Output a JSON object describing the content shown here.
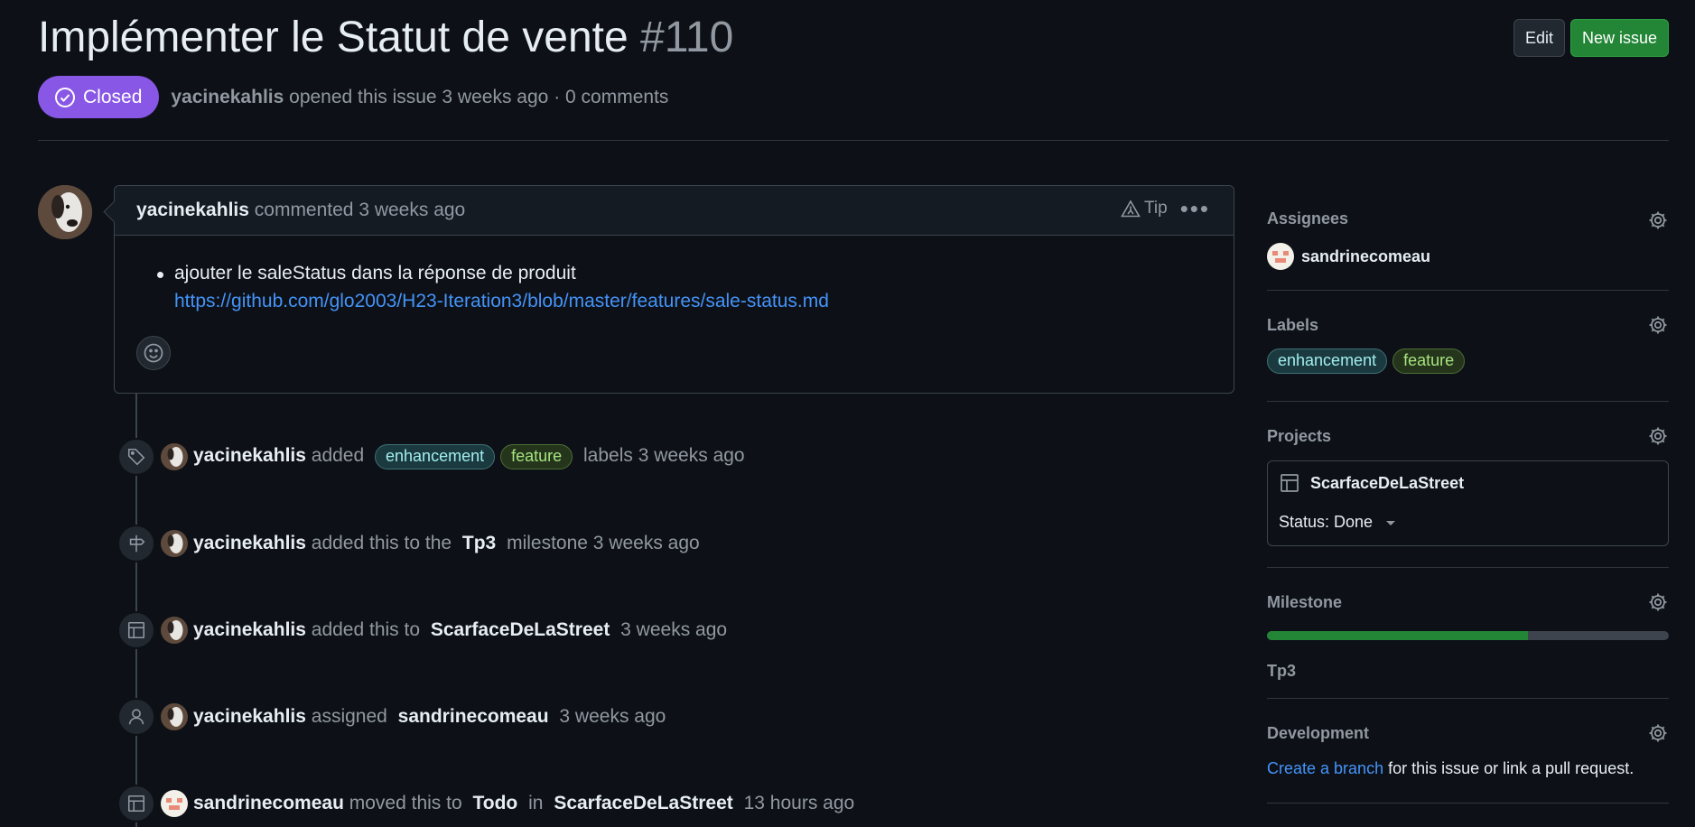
{
  "issue": {
    "title": "Implémenter le Statut de vente",
    "number": "#110",
    "state": "Closed",
    "author": "yacinekahlis",
    "opened_text": "opened this issue 3 weeks ago",
    "sep": "·",
    "comments": "0 comments"
  },
  "header_buttons": {
    "edit": "Edit",
    "new_issue": "New issue"
  },
  "comment": {
    "author": "yacinekahlis",
    "meta": "commented 3 weeks ago",
    "tip": "Tip",
    "more": "•••",
    "bullet_text": "ajouter le saleStatus dans la réponse de produit",
    "link": "https://github.com/glo2003/H23-Iteration3/blob/master/features/sale-status.md"
  },
  "timeline": [
    {
      "icon": "tag-icon",
      "actor": "yacinekahlis",
      "parts": [
        "added"
      ],
      "labels": [
        "enhancement",
        "feature"
      ],
      "tail": "labels 3 weeks ago"
    },
    {
      "icon": "milestone-icon",
      "actor": "yacinekahlis",
      "text1": "added this to the",
      "bold1": "Tp3",
      "text2": "milestone 3 weeks ago"
    },
    {
      "icon": "table-icon",
      "actor": "yacinekahlis",
      "text1": "added this to",
      "bold1": "ScarfaceDeLaStreet",
      "text2": "3 weeks ago"
    },
    {
      "icon": "person-icon",
      "actor": "yacinekahlis",
      "text1": "assigned",
      "bold1": "sandrinecomeau",
      "text2": "3 weeks ago"
    },
    {
      "icon": "table-icon",
      "actor": "sandrinecomeau",
      "text1": "moved this to",
      "bold1": "Todo",
      "text2": "in",
      "bold2": "ScarfaceDeLaStreet",
      "text3": "13 hours ago"
    }
  ],
  "sidebar": {
    "assignees": {
      "title": "Assignees",
      "name": "sandrinecomeau"
    },
    "labels": {
      "title": "Labels",
      "items": [
        "enhancement",
        "feature"
      ]
    },
    "projects": {
      "title": "Projects",
      "name": "ScarfaceDeLaStreet",
      "status": "Status: Done"
    },
    "milestone": {
      "title": "Milestone",
      "name": "Tp3",
      "progress": 0.65
    },
    "development": {
      "title": "Development",
      "link": "Create a branch",
      "text": "for this issue or link a pull request."
    }
  },
  "colors": {
    "closed": "#8957e5",
    "primary": "#238636",
    "link": "#4493f8"
  }
}
